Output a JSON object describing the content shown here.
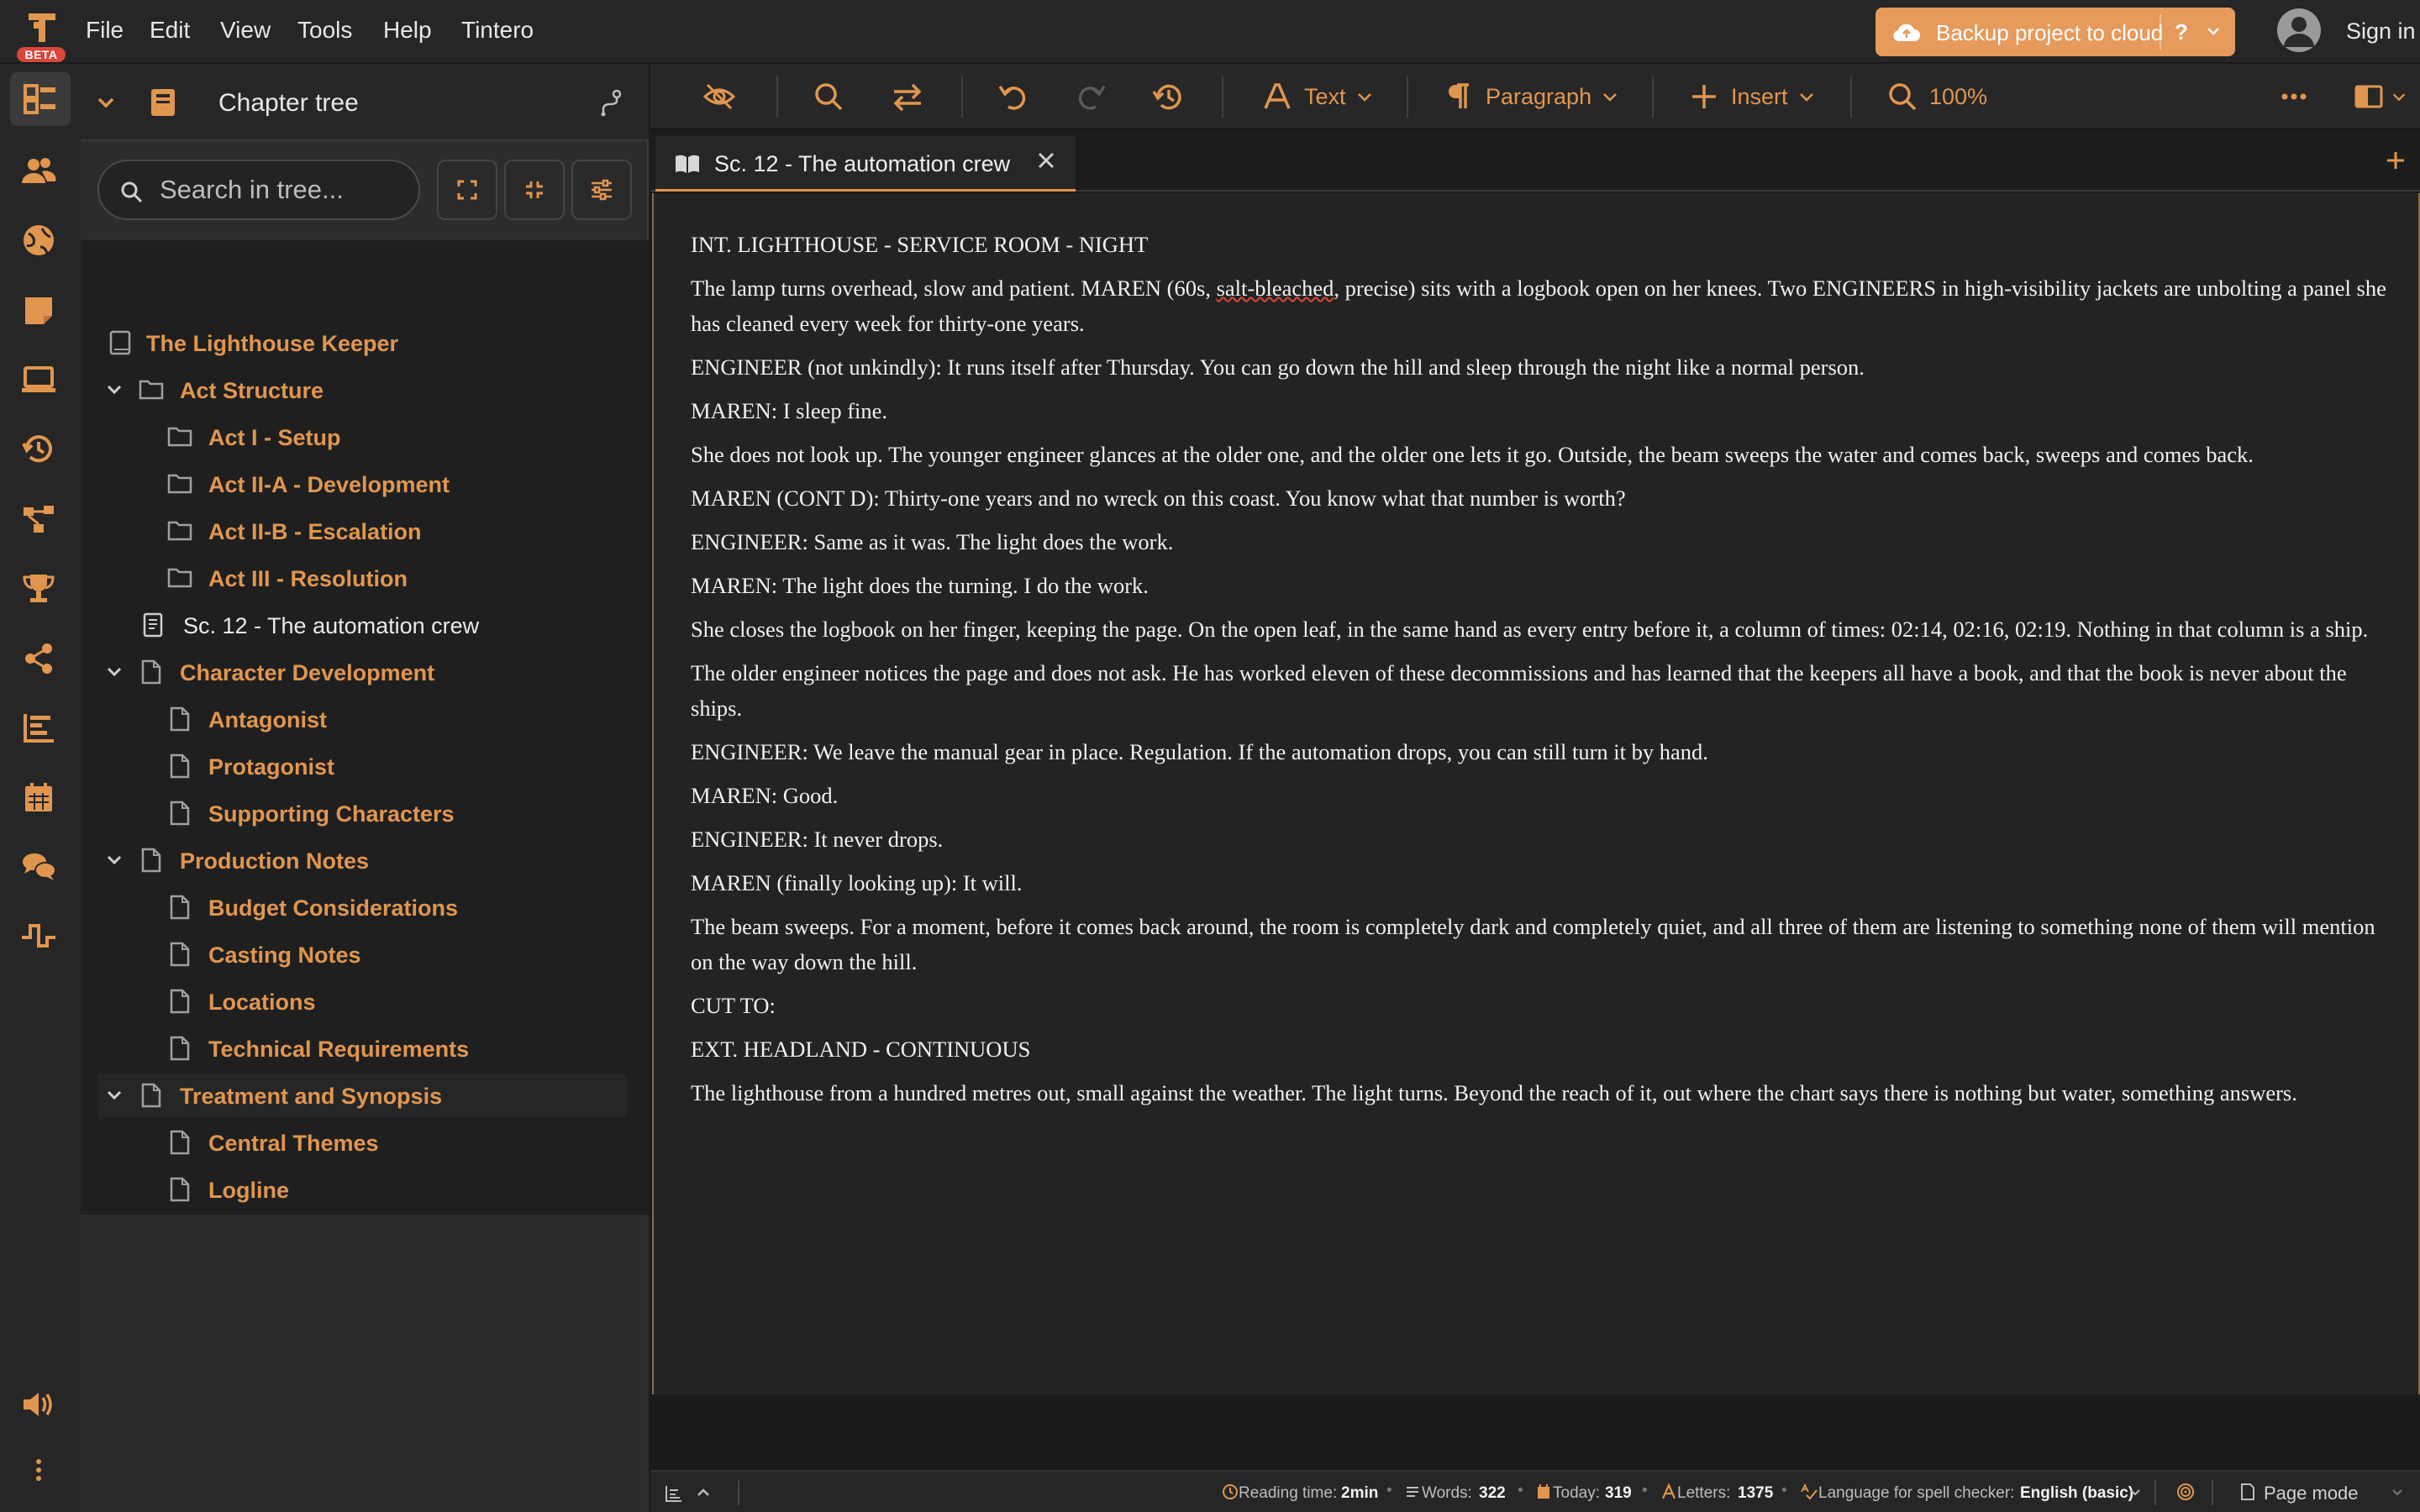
{
  "app": {
    "logo_badge": "BETA",
    "menu": [
      "File",
      "Edit",
      "View",
      "Tools",
      "Help",
      "Tintero"
    ],
    "backup_label": "Backup project to cloud",
    "help_label": "?",
    "signin_label": "Sign in",
    "accent": "#e0964f"
  },
  "rail": {
    "icons": [
      "chapter-tree-icon",
      "characters-icon",
      "world-icon",
      "notes-icon",
      "preview-icon",
      "history-icon",
      "structure-icon",
      "goals-icon",
      "share-icon",
      "stats-icon",
      "calendar-icon",
      "chat-icon",
      "timeline-icon",
      "sound-icon",
      "more-icon"
    ]
  },
  "tree": {
    "title": "Chapter tree",
    "search_placeholder": "Search in tree...",
    "items": [
      {
        "label": "The Lighthouse Keeper"
      },
      {
        "label": "Act Structure"
      },
      {
        "label": "Act I - Setup"
      },
      {
        "label": "Act II-A - Development"
      },
      {
        "label": "Act II-B - Escalation"
      },
      {
        "label": "Act III - Resolution"
      },
      {
        "label": "Sc. 12 - The automation crew"
      },
      {
        "label": "Character Development"
      },
      {
        "label": "Antagonist"
      },
      {
        "label": "Protagonist"
      },
      {
        "label": "Supporting Characters"
      },
      {
        "label": "Production Notes"
      },
      {
        "label": "Budget Considerations"
      },
      {
        "label": "Casting Notes"
      },
      {
        "label": "Locations"
      },
      {
        "label": "Technical Requirements"
      },
      {
        "label": "Treatment and Synopsis"
      },
      {
        "label": "Central Themes"
      },
      {
        "label": "Logline"
      }
    ]
  },
  "toolbar": {
    "text_label": "Text",
    "paragraph_label": "Paragraph",
    "insert_label": "Insert",
    "zoom_label": "100%"
  },
  "tab": {
    "label": "Sc. 12 - The automation crew"
  },
  "document": {
    "p1": "INT. LIGHTHOUSE - SERVICE ROOM - NIGHT",
    "p2a": "The lamp turns overhead, slow and patient. MAREN (60s, ",
    "p2b": "salt-bleached",
    "p2c": ", precise) sits with a logbook open on her knees. Two ENGINEERS in high-visibility jackets are unbolting a panel she has cleaned every week for thirty-one years.",
    "p3": "ENGINEER (not unkindly): It runs itself after Thursday. You can go down the hill and sleep through the night like a normal person.",
    "p4": "MAREN: I sleep fine.",
    "p5": "She does not look up. The younger engineer glances at the older one, and the older one lets it go. Outside, the beam sweeps the water and comes back, sweeps and comes back.",
    "p6": "MAREN (CONT D): Thirty-one years and no wreck on this coast. You know what that number is worth?",
    "p7": "ENGINEER: Same as it was. The light does the work.",
    "p8": "MAREN: The light does the turning. I do the work.",
    "p9": "She closes the logbook on her finger, keeping the page. On the open leaf, in the same hand as every entry before it, a column of times: 02:14, 02:16, 02:19. Nothing in that column is a ship.",
    "p10": "The older engineer notices the page and does not ask. He has worked eleven of these decommissions and has learned that the keepers all have a book, and that the book is never about the ships.",
    "p11": "ENGINEER: We leave the manual gear in place. Regulation. If the automation drops, you can still turn it by hand.",
    "p12": "MAREN: Good.",
    "p13": "ENGINEER: It never drops.",
    "p14": "MAREN (finally looking up): It will.",
    "p15": "The beam sweeps. For a moment, before it comes back around, the room is completely dark and completely quiet, and all three of them are listening to something none of them will mention on the way down the hill.",
    "p16": "CUT TO:",
    "p17": "EXT. HEADLAND - CONTINUOUS",
    "p18": "The lighthouse from a hundred metres out, small against the weather. The light turns. Beyond the reach of it, out where the chart says there is nothing but water, something answers."
  },
  "status": {
    "reading_label": "Reading time:",
    "reading_value": "2min",
    "words_label": "Words:",
    "words_value": "322",
    "today_label": "Today:",
    "today_value": "319",
    "letters_label": "Letters:",
    "letters_value": "1375",
    "lang_label": "Language for spell checker:",
    "lang_value": "English (basic)",
    "mode_label": "Page mode"
  }
}
